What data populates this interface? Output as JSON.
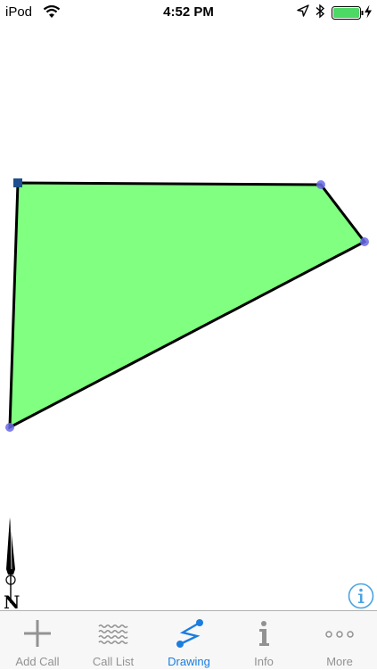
{
  "status_bar": {
    "carrier": "iPod",
    "time": "4:52 PM",
    "icons": [
      "wifi-icon",
      "location-arrow-icon",
      "bluetooth-icon",
      "battery-icon",
      "charging-bolt-icon"
    ],
    "battery_level_percent": 100,
    "battery_color": "#4cd964"
  },
  "drawing": {
    "fill_color": "#80ff80",
    "stroke_color": "#000000",
    "vertex_color": "#6a6ae8",
    "start_vertex_color": "#1f4f8f",
    "north_label": "N"
  },
  "tab_bar": {
    "accent_color": "#1a7ee0",
    "tabs": [
      {
        "label": "Add Call",
        "icon": "plus-icon",
        "active": false
      },
      {
        "label": "Call List",
        "icon": "wavy-lines-icon",
        "active": false
      },
      {
        "label": "Drawing",
        "icon": "polyline-icon",
        "active": true
      },
      {
        "label": "Info",
        "icon": "info-i-icon",
        "active": false
      },
      {
        "label": "More",
        "icon": "more-dots-icon",
        "active": false
      }
    ]
  }
}
